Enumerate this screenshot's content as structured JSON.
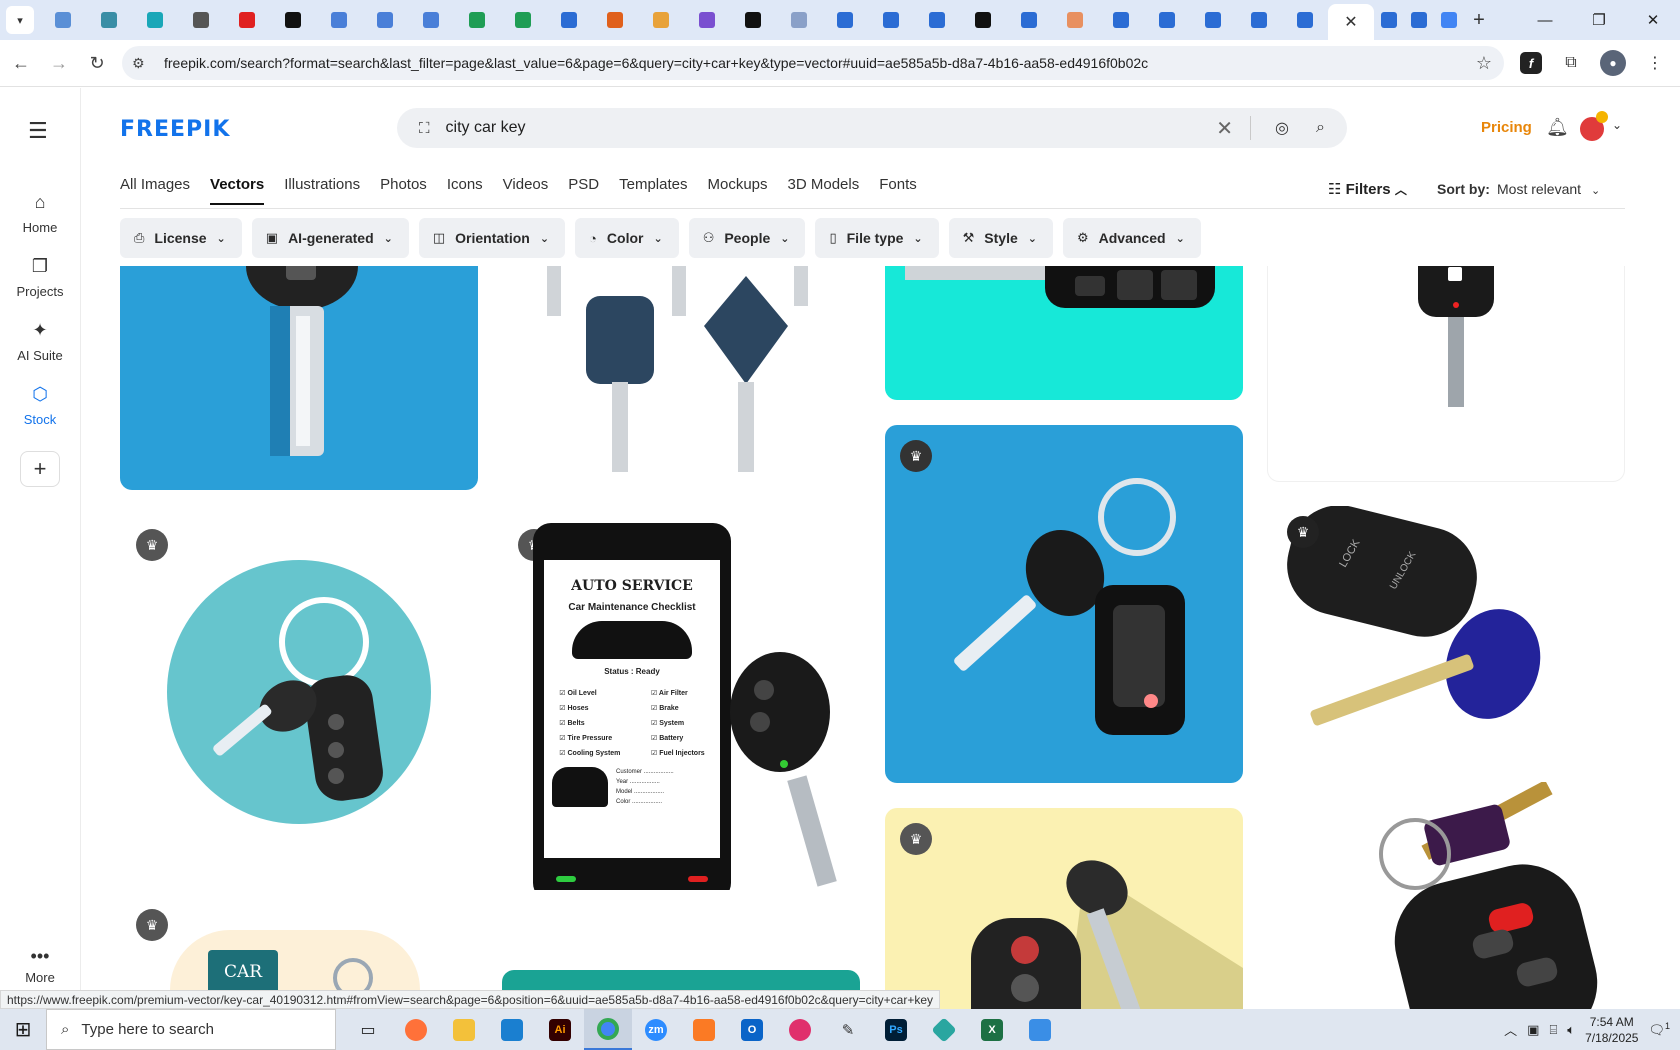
{
  "browser": {
    "url": "freepik.com/search?format=search&last_filter=page&last_value=6&page=6&query=city+car+key&type=vector#uuid=ae585a5b-d8a7-4b16-aa58-ed4916f0b02c",
    "status_url": "https://www.freepik.com/premium-vector/key-car_40190312.htm#fromView=search&page=6&position=6&uuid=ae585a5b-d8a7-4b16-aa58-ed4916f0b02c&query=city+car+key",
    "tab_colors": [
      "#5a8fd6",
      "#3a8ea6",
      "#1aa7b8",
      "#555555",
      "#e02020",
      "#111111",
      "#4a7fd8",
      "#4a7fd8",
      "#4a7fd8",
      "#1f9d55",
      "#1f9d55",
      "#2b6cd4",
      "#e0601c",
      "#e8a23a",
      "#7a4fd0",
      "#111111",
      "#8aa0c8",
      "#2b6cd4",
      "#2b6cd4",
      "#2b6cd4",
      "#111111",
      "#2b6cd4",
      "#e89060",
      "#2b6cd4",
      "#2b6cd4",
      "#2b6cd4",
      "#2b6cd4",
      "#2b6cd4"
    ],
    "after_active_colors": [
      "#2b6cd4",
      "#2b6cd4",
      "#4285f4"
    ]
  },
  "sidebar": {
    "items": [
      {
        "label": "Home",
        "icon": "home-icon"
      },
      {
        "label": "Projects",
        "icon": "projects-icon"
      },
      {
        "label": "AI Suite",
        "icon": "sparkle-icon"
      },
      {
        "label": "Stock",
        "icon": "stock-icon"
      }
    ],
    "more_label": "More"
  },
  "header": {
    "logo": "FREEPIK",
    "search_value": "city car key",
    "pricing": "Pricing"
  },
  "tabs": [
    "All Images",
    "Vectors",
    "Illustrations",
    "Photos",
    "Icons",
    "Videos",
    "PSD",
    "Templates",
    "Mockups",
    "3D Models",
    "Fonts"
  ],
  "active_tab": "Vectors",
  "filters_label": "Filters",
  "sort": {
    "label": "Sort by:",
    "value": "Most relevant"
  },
  "chips": [
    {
      "label": "License",
      "icon": "license-icon"
    },
    {
      "label": "AI-generated",
      "icon": "ai-icon"
    },
    {
      "label": "Orientation",
      "icon": "orientation-icon"
    },
    {
      "label": "Color",
      "icon": "palette-icon"
    },
    {
      "label": "People",
      "icon": "people-icon"
    },
    {
      "label": "File type",
      "icon": "file-icon"
    },
    {
      "label": "Style",
      "icon": "brush-icon"
    },
    {
      "label": "Advanced",
      "icon": "gear-icon"
    }
  ],
  "cards": {
    "auto_service_title": "AUTO SERVICE",
    "checklist_title": "Car Maintenance Checklist",
    "status": "Status : Ready",
    "checklist_left": [
      "Oil Level",
      "Hoses",
      "Belts",
      "Tire Pressure",
      "Cooling System"
    ],
    "checklist_right": [
      "Air Filter",
      "Brake",
      "System",
      "Battery",
      "Fuel Injectors"
    ],
    "form_fields": [
      "Customer",
      "Year",
      "Model",
      "Color"
    ],
    "car_rent": "CAR RENT",
    "lock": "LOCK",
    "unlock": "UNLOCK"
  },
  "taskbar": {
    "search_placeholder": "Type here to search",
    "time": "7:54 AM",
    "date": "7/18/2025",
    "notifications": "1"
  }
}
